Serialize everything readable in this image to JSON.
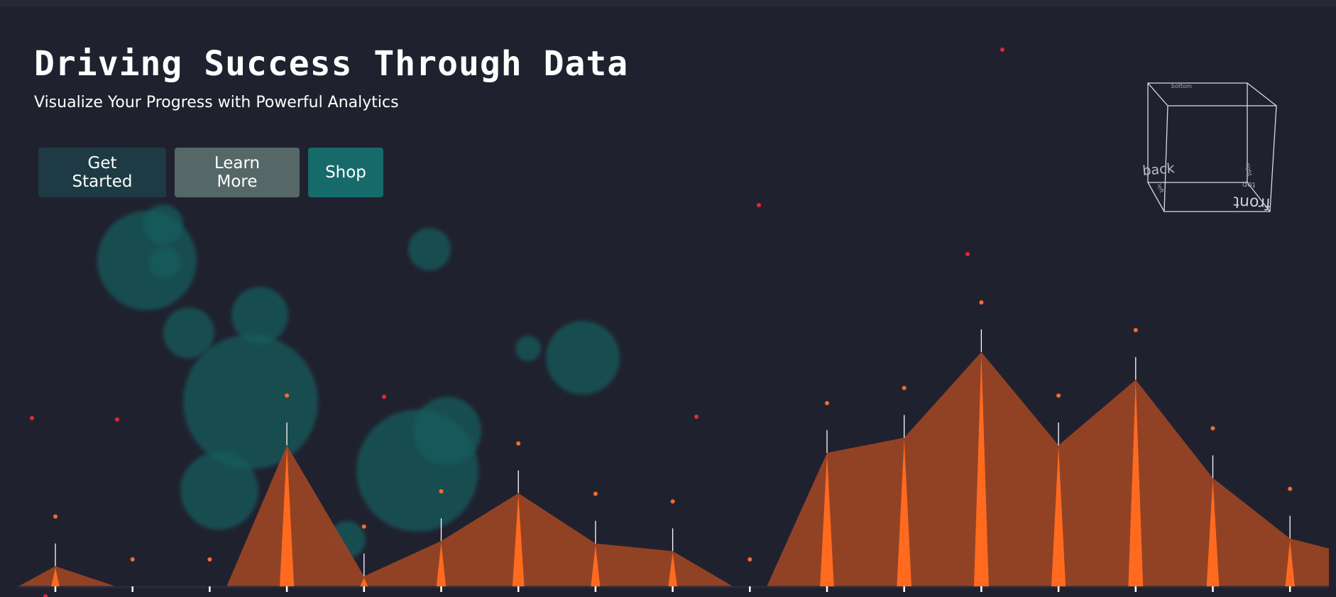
{
  "hero": {
    "title": "Driving Success Through Data",
    "subtitle": "Visualize Your Progress with Powerful Analytics"
  },
  "buttons": {
    "get_started": "Get Started",
    "learn_more": "Learn More",
    "shop": "Shop"
  },
  "cube": {
    "faces": [
      "back",
      "front",
      "top",
      "bottom",
      "left",
      "right"
    ]
  },
  "colors": {
    "background": "#20212f",
    "area_fill": "#954325",
    "spike": "#ff6a1f",
    "dot_orange": "#f26d2c",
    "dot_red": "#e0283a",
    "bubble": "#165e5e",
    "btn_get_started": "#1e3b45",
    "btn_learn_more": "#566767",
    "btn_shop": "#166a6a"
  },
  "chart_data": {
    "type": "area",
    "series": [
      {
        "values": [
          8,
          0,
          0,
          56,
          4,
          18,
          37,
          17,
          14,
          0,
          53,
          59,
          93,
          56,
          82,
          43,
          19
        ]
      }
    ]
  }
}
